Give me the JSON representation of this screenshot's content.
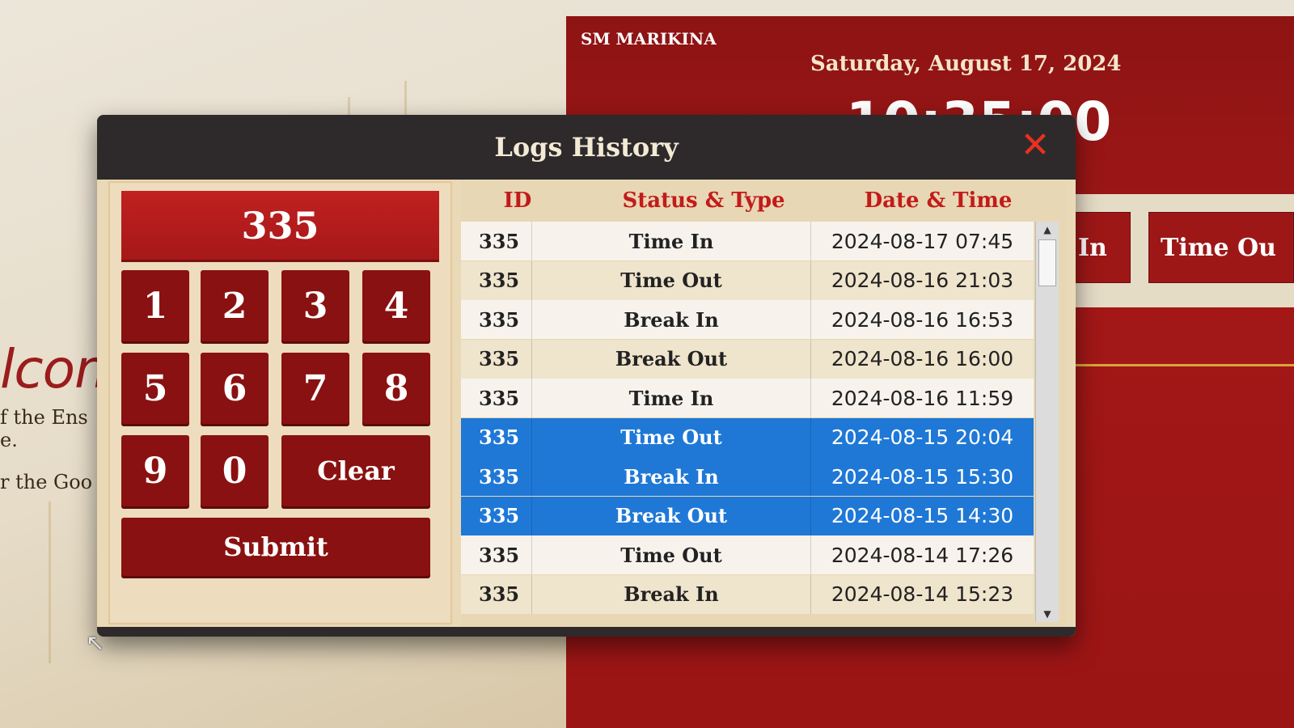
{
  "background": {
    "branch": "SM MARIKINA",
    "date": "Saturday, August 17, 2024",
    "clock": "10:35:00",
    "welcome_fragment": "lcom",
    "sub_lines": [
      "f the Ens",
      "e.",
      "r the Goo"
    ],
    "buttons": {
      "in_partial": "In",
      "time_out_partial": "Time Ou"
    }
  },
  "modal": {
    "title": "Logs History",
    "close_icon": "close-icon"
  },
  "keypad": {
    "display_value": "335",
    "keys": [
      "1",
      "2",
      "3",
      "4",
      "5",
      "6",
      "7",
      "8",
      "9",
      "0"
    ],
    "clear_label": "Clear",
    "submit_label": "Submit"
  },
  "table": {
    "headers": {
      "id": "ID",
      "status": "Status & Type",
      "datetime": "Date & Time"
    },
    "rows": [
      {
        "id": "335",
        "status": "Time In",
        "datetime": "2024-08-17 07:45",
        "selected": false
      },
      {
        "id": "335",
        "status": "Time Out",
        "datetime": "2024-08-16 21:03",
        "selected": false
      },
      {
        "id": "335",
        "status": "Break In",
        "datetime": "2024-08-16 16:53",
        "selected": false
      },
      {
        "id": "335",
        "status": "Break Out",
        "datetime": "2024-08-16 16:00",
        "selected": false
      },
      {
        "id": "335",
        "status": "Time In",
        "datetime": "2024-08-16 11:59",
        "selected": false
      },
      {
        "id": "335",
        "status": "Time Out",
        "datetime": "2024-08-15 20:04",
        "selected": true
      },
      {
        "id": "335",
        "status": "Break In",
        "datetime": "2024-08-15 15:30",
        "selected": true
      },
      {
        "id": "335",
        "status": "Break Out",
        "datetime": "2024-08-15 14:30",
        "selected": true
      },
      {
        "id": "335",
        "status": "Time Out",
        "datetime": "2024-08-14 17:26",
        "selected": false
      },
      {
        "id": "335",
        "status": "Break In",
        "datetime": "2024-08-14 15:23",
        "selected": false
      }
    ]
  },
  "colors": {
    "brand_red": "#9e1717",
    "selection_blue": "#1f78d6",
    "header_dark": "#2e2a2b",
    "close_red": "#e8311f"
  }
}
